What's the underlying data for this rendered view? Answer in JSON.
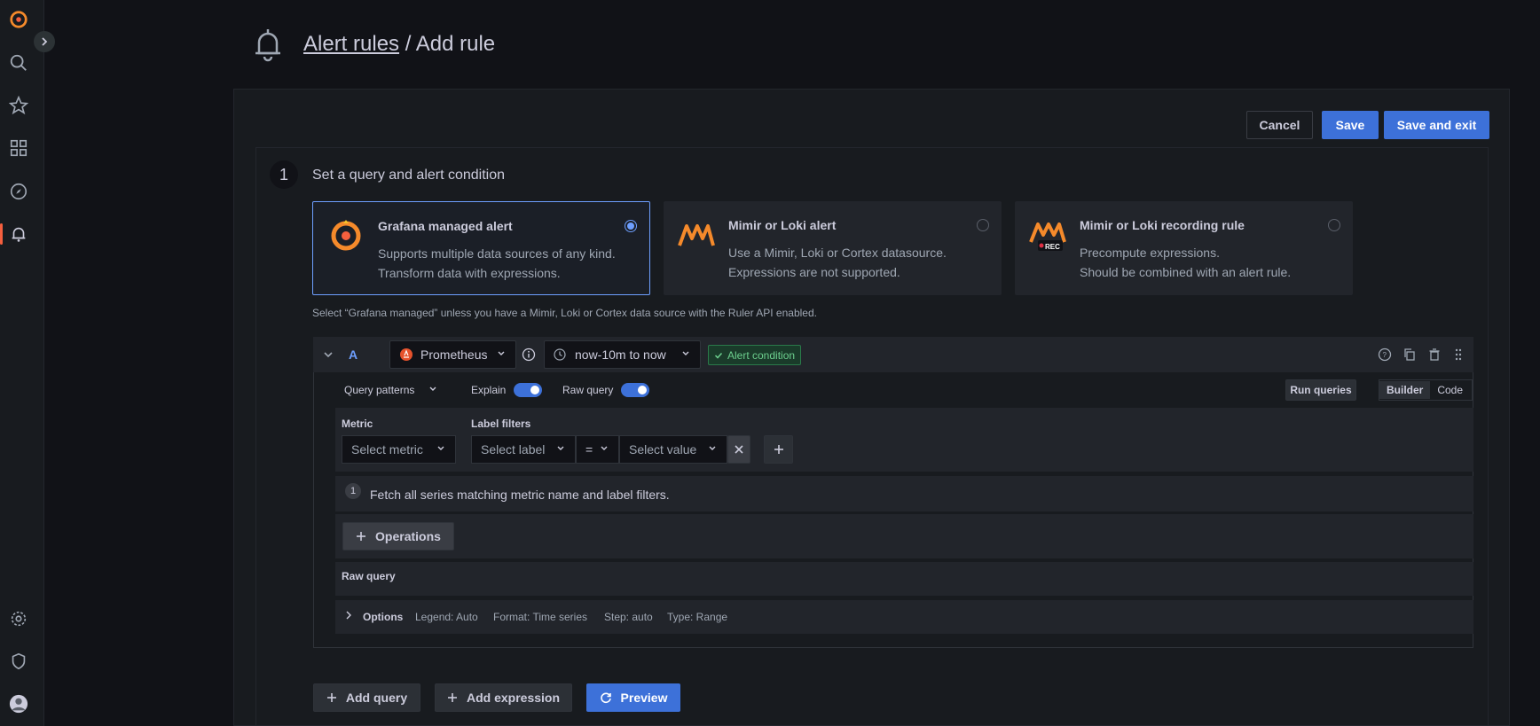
{
  "header": {
    "breadcrumb_link": "Alert rules",
    "separator": " / ",
    "title": "Add rule"
  },
  "actions": {
    "cancel": "Cancel",
    "save": "Save",
    "save_exit": "Save and exit"
  },
  "step": {
    "number": "1",
    "title": "Set a query and alert condition"
  },
  "cards": [
    {
      "title": "Grafana managed alert",
      "line1": "Supports multiple data sources of any kind.",
      "line2": "Transform data with expressions.",
      "selected": true
    },
    {
      "title": "Mimir or Loki alert",
      "line1": "Use a Mimir, Loki or Cortex datasource.",
      "line2": "Expressions are not supported.",
      "selected": false
    },
    {
      "title": "Mimir or Loki recording rule",
      "line1": "Precompute expressions.",
      "line2": "Should be combined with an alert rule.",
      "selected": false,
      "badge": "REC"
    }
  ],
  "hint": "Select “Grafana managed” unless you have a Mimir, Loki or Cortex data source with the Ruler API enabled.",
  "query": {
    "letter": "A",
    "datasource": "Prometheus",
    "time_range": "now-10m to now",
    "alert_condition": "Alert condition",
    "query_patterns": "Query patterns",
    "explain": "Explain",
    "raw_query_toggle": "Raw query",
    "run_queries": "Run queries",
    "mode_builder": "Builder",
    "mode_code": "Code",
    "metric_label": "Metric",
    "metric_placeholder": "Select metric",
    "label_filters": "Label filters",
    "label_placeholder": "Select label",
    "operator": "=",
    "value_placeholder": "Select value",
    "step_num": "1",
    "fetch_text": "Fetch all series matching metric name and label filters.",
    "operations": "Operations",
    "raw_query_section": "Raw query",
    "options_label": "Options",
    "legend": "Legend: Auto",
    "format": "Format: Time series",
    "step": "Step: auto",
    "type": "Type: Range"
  },
  "footer_buttons": {
    "add_query": "Add query",
    "add_expression": "Add expression",
    "preview": "Preview"
  },
  "colors": {
    "primary": "#3d71d9",
    "accent": "#f55f3e",
    "selected_border": "#6e9fff"
  }
}
